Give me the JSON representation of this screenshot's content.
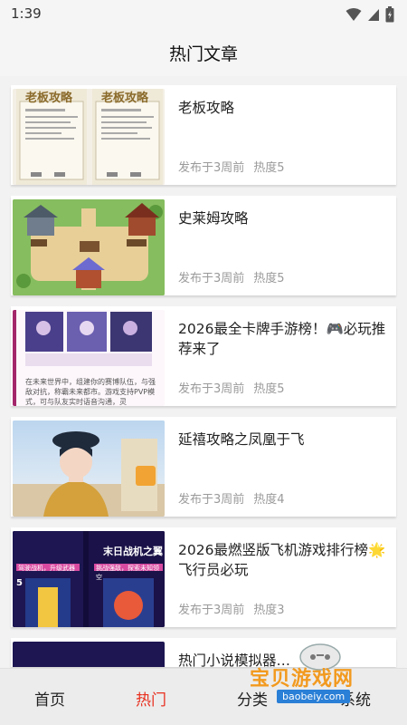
{
  "status": {
    "time": "1:39"
  },
  "header": {
    "title": "热门文章"
  },
  "articles": [
    {
      "title": "老板攻略",
      "date": "发布于3周前",
      "heat": "热度5"
    },
    {
      "title": "史莱姆攻略",
      "date": "发布于3周前",
      "heat": "热度5"
    },
    {
      "title": "2026最全卡牌手游榜！🎮必玩推荐来了",
      "date": "发布于3周前",
      "heat": "热度5"
    },
    {
      "title": "延禧攻略之凤凰于飞",
      "date": "发布于3周前",
      "heat": "热度4"
    },
    {
      "title": "2026最燃竖版飞机游戏排行榜🌟飞行员必玩",
      "date": "发布于3周前",
      "heat": "热度3"
    },
    {
      "title": "热门小说模拟器…",
      "date": "",
      "heat": ""
    }
  ],
  "thumbs": {
    "t1_heading": "老板攻略",
    "t3_caption": "在未来世界中，组建你的赛博队伍，与强敌对抗，称霸未来都市。游戏支持PVP模式，可与队友实时语音沟通，灵",
    "t5_left_a": "驾驶战机，升级武器",
    "t5_right_title": "末日战机之翼",
    "t5_right_sub": "挑战强敌，探索未知领空",
    "t5_num": "5"
  },
  "tabs": [
    {
      "label": "首页",
      "active": false
    },
    {
      "label": "热门",
      "active": true
    },
    {
      "label": "分类",
      "active": false
    },
    {
      "label": "系统",
      "active": false
    }
  ],
  "watermark": {
    "brand": "宝贝游戏网",
    "url": "baobeiy.com"
  },
  "colors": {
    "accent": "#e8301f",
    "background": "#f2f2f2"
  }
}
